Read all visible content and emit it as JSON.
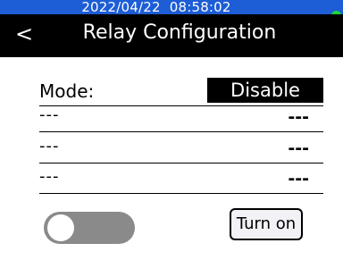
{
  "status_bar": {
    "datetime": "2022/04/22  08:58:02",
    "indicator_color": "#1fd63a",
    "background_color": "#1d5dd6"
  },
  "header": {
    "back_label": "<",
    "title": "Relay Configuration"
  },
  "mode_row": {
    "label": "Mode:",
    "value": "Disable"
  },
  "rows": [
    {
      "label": "---",
      "value": "---"
    },
    {
      "label": "---",
      "value": "---"
    },
    {
      "label": "---",
      "value": "---"
    }
  ],
  "toggle": {
    "state": "off",
    "track_color": "#8a8a8a"
  },
  "action_button": {
    "label": "Turn on"
  }
}
